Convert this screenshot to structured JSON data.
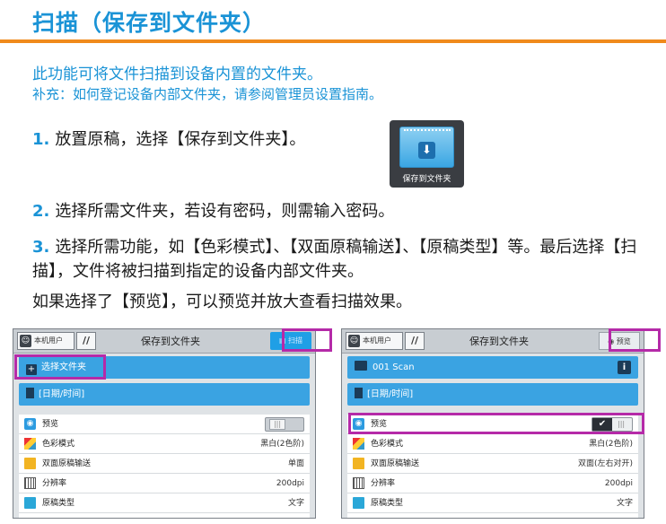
{
  "header": {
    "title": "扫描（保存到文件夹）"
  },
  "intro": {
    "line1": "此功能可将文件扫描到设备内置的文件夹。",
    "line2": "补充：如何登记设备内部文件夹，请参阅管理员设置指南。"
  },
  "steps": [
    {
      "num": "1.",
      "text": "放置原稿，选择【保存到文件夹】。"
    },
    {
      "num": "2.",
      "text": "选择所需文件夹，若设有密码，则需输入密码。"
    },
    {
      "num": "3.",
      "text": "选择所需功能，如【色彩模式】、【双面原稿输送】、【原稿类型】等。最后选择【扫描】，文件将被扫描到指定的设备内部文件夹。"
    }
  ],
  "note": "如果选择了【预览】，可以预览并放大查看扫描效果。",
  "app_icon": {
    "label": "保存到文件夹",
    "icon": "folder-download-icon"
  },
  "colors": {
    "accent_blue": "#1a93d6",
    "rule_orange": "#f08a1c",
    "highlight": "#b52aa8",
    "bar_blue": "#3aa3e2"
  },
  "panel_left": {
    "user_label": "本机用户",
    "tool_symbol": "//",
    "title": "保存到文件夹",
    "scan_label": "扫描",
    "select_folder_label": "选择文件夹",
    "datetime_label": "[日期/时间]",
    "rows": [
      {
        "label": "预览",
        "value": "",
        "icon": "eye-icon"
      },
      {
        "label": "色彩模式",
        "value": "黑白(2色阶)",
        "icon": "color-mode-icon"
      },
      {
        "label": "双面原稿输送",
        "value": "单面",
        "icon": "duplex-icon"
      },
      {
        "label": "分辨率",
        "value": "200dpi",
        "icon": "resolution-icon"
      },
      {
        "label": "原稿类型",
        "value": "文字",
        "icon": "original-type-icon"
      }
    ],
    "preview_on": false
  },
  "panel_right": {
    "user_label": "本机用户",
    "tool_symbol": "//",
    "title": "保存到文件夹",
    "preview_label": "预览",
    "folder_label": "001 Scan",
    "info_symbol": "i",
    "datetime_label": "[日期/时间]",
    "rows": [
      {
        "label": "预览",
        "value": "",
        "icon": "eye-icon"
      },
      {
        "label": "色彩模式",
        "value": "黑白(2色阶)",
        "icon": "color-mode-icon"
      },
      {
        "label": "双面原稿输送",
        "value": "双面(左右对开)",
        "icon": "duplex-icon"
      },
      {
        "label": "分辨率",
        "value": "200dpi",
        "icon": "resolution-icon"
      },
      {
        "label": "原稿类型",
        "value": "文字",
        "icon": "original-type-icon"
      }
    ],
    "preview_on": true
  }
}
